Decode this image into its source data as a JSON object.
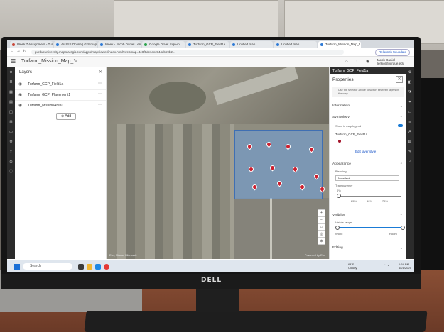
{
  "browser": {
    "tabs": [
      {
        "label": "Week 7 Assignment - Turfgras",
        "color": "#c94a3c"
      },
      {
        "label": "ArcGIS Online | GIS mapping",
        "color": "#2f7bd6"
      },
      {
        "label": "Week - Jacob Daniel Lenko",
        "color": "#2f7bd6"
      },
      {
        "label": "Google Drive: Sign-in",
        "color": "#2da44e"
      },
      {
        "label": "Turfarm_GCP_Field1a",
        "color": "#2f7bd6"
      },
      {
        "label": "Untitled map",
        "color": "#2f7bd6"
      },
      {
        "label": "Untitled map",
        "color": "#2f7bd6"
      },
      {
        "label": "Turfarm_Mission_Map_1",
        "color": "#2f7bd6"
      }
    ],
    "url": "purdueuniversity.maps.arcgis.com/apps/mapviewer/index.html?webmap=3e8f0dc1ecc944ebb9b2...",
    "relaunch_label": "Relaunch to update"
  },
  "app": {
    "title": "Turfarm_Mission_Map_1",
    "user_name": "Jacob Daniel",
    "user_email": "jlenko@purdue.edu"
  },
  "layers": {
    "title": "Layers",
    "items": [
      {
        "label": "Turfarm_GCP_Field1a"
      },
      {
        "label": "Turfarm_GCP_Placement1"
      },
      {
        "label": "Turfarm_MissionArea1"
      }
    ],
    "add_label": "Add"
  },
  "map": {
    "attribution": "Esri, Maxar, Microsoft",
    "powered": "Powered by Esri",
    "aoi_color": "#6ea0dc",
    "pin_color": "#cc1f2e"
  },
  "properties": {
    "header": "Turfarm_GCP_Field1a",
    "title": "Properties",
    "hint": "Use the selector above to switch between layers in the map.",
    "information": "Information",
    "symbology": "Symbology",
    "show_in_legend": "Show in map legend",
    "symbol_layer": "Turfarm_GCP_Field1a",
    "edit_style": "Edit layer style",
    "appearance": "Appearance",
    "blending": "Blending",
    "blending_value": "No effect",
    "transparency": "Transparency",
    "transparency_value": "0%",
    "ticks": [
      "25%",
      "50%",
      "75%"
    ],
    "visibility": "Visibility",
    "visible_range": "Visible range",
    "world": "World",
    "room": "Room",
    "editing": "Editing"
  },
  "taskbar": {
    "search_placeholder": "Search",
    "weather_temp": "64°F",
    "weather_desc": "Cloudy",
    "time": "1:54 PM",
    "date": "4/21/2025"
  },
  "monitor_brand": "DELL"
}
